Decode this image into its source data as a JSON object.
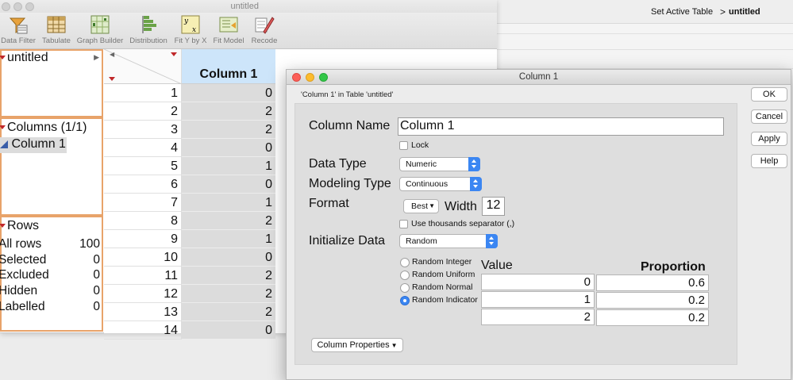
{
  "main_window": {
    "title": "untitled"
  },
  "toolbar": [
    {
      "label": "Data Filter",
      "icon": "data-filter-icon"
    },
    {
      "label": "Tabulate",
      "icon": "tabulate-icon"
    },
    {
      "label": "Graph Builder",
      "icon": "graph-builder-icon"
    },
    {
      "label": "Distribution",
      "icon": "distribution-icon"
    },
    {
      "label": "Fit Y by X",
      "icon": "fit-y-by-x-icon"
    },
    {
      "label": "Fit Model",
      "icon": "fit-model-icon"
    },
    {
      "label": "Recode",
      "icon": "recode-icon"
    }
  ],
  "table_panel": {
    "name": "untitled"
  },
  "columns_panel": {
    "header": "Columns (1/1)",
    "items": [
      "Column 1"
    ]
  },
  "rows_panel": {
    "header": "Rows",
    "items": [
      {
        "label": "All rows",
        "value": "100"
      },
      {
        "label": "Selected",
        "value": "0"
      },
      {
        "label": "Excluded",
        "value": "0"
      },
      {
        "label": "Hidden",
        "value": "0"
      },
      {
        "label": "Labelled",
        "value": "0"
      }
    ]
  },
  "grid": {
    "column_header": "Column 1",
    "rows": [
      {
        "n": "1",
        "v": "0"
      },
      {
        "n": "2",
        "v": "2"
      },
      {
        "n": "3",
        "v": "2"
      },
      {
        "n": "4",
        "v": "0"
      },
      {
        "n": "5",
        "v": "1"
      },
      {
        "n": "6",
        "v": "0"
      },
      {
        "n": "7",
        "v": "1"
      },
      {
        "n": "8",
        "v": "2"
      },
      {
        "n": "9",
        "v": "1"
      },
      {
        "n": "10",
        "v": "0"
      },
      {
        "n": "11",
        "v": "2"
      },
      {
        "n": "12",
        "v": "2"
      },
      {
        "n": "13",
        "v": "2"
      },
      {
        "n": "14",
        "v": "0"
      }
    ]
  },
  "background": {
    "set_active_label": "Set Active Table",
    "chevron": ">",
    "active_table": "untitled"
  },
  "dialog": {
    "title": "Column 1",
    "subheader": "'Column 1' in Table 'untitled'",
    "column_name_label": "Column Name",
    "column_name_value": "Column 1",
    "lock_label": "Lock",
    "data_type_label": "Data Type",
    "data_type_value": "Numeric",
    "modeling_type_label": "Modeling Type",
    "modeling_type_value": "Continuous",
    "format_label": "Format",
    "format_value": "Best",
    "width_label": "Width",
    "width_value": "12",
    "thousands_label": "Use thousands separator (,)",
    "init_label": "Initialize Data",
    "init_value": "Random",
    "random_options": [
      {
        "label": "Random Integer",
        "selected": false
      },
      {
        "label": "Random Uniform",
        "selected": false
      },
      {
        "label": "Random Normal",
        "selected": false
      },
      {
        "label": "Random Indicator",
        "selected": true
      }
    ],
    "value_header": "Value",
    "proportion_header": "Proportion",
    "table": [
      {
        "value": "0",
        "proportion": "0.6"
      },
      {
        "value": "1",
        "proportion": "0.2"
      },
      {
        "value": "2",
        "proportion": "0.2"
      }
    ],
    "column_properties_label": "Column Properties",
    "buttons": {
      "ok": "OK",
      "cancel": "Cancel",
      "apply": "Apply",
      "help": "Help"
    }
  }
}
